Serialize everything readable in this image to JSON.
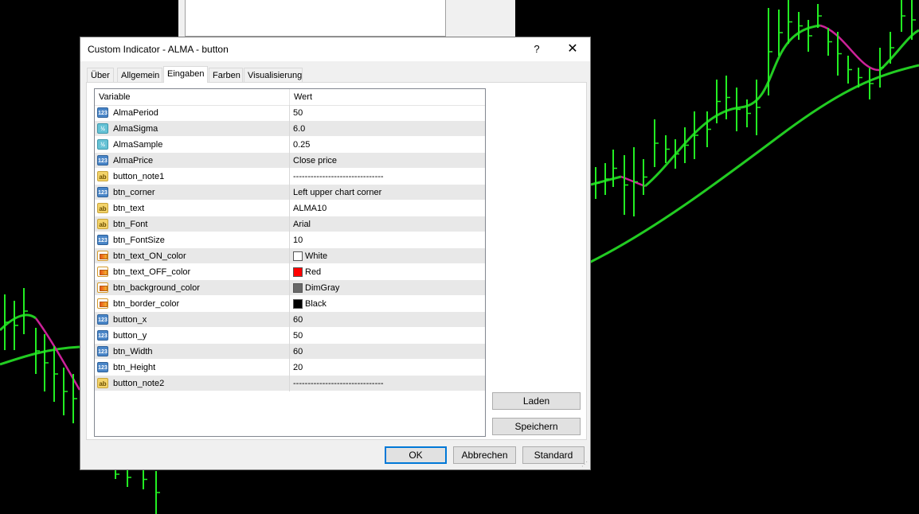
{
  "dialog": {
    "title": "Custom Indicator - ALMA  - button",
    "help_label": "?",
    "close_label": "✕"
  },
  "tabs": [
    {
      "label": "Über"
    },
    {
      "label": "Allgemein"
    },
    {
      "label": "Eingaben"
    },
    {
      "label": "Farben"
    },
    {
      "label": "Visualisierung"
    }
  ],
  "table": {
    "headers": {
      "variable": "Variable",
      "value": "Wert"
    },
    "rows": [
      {
        "type": "int",
        "icon": "123",
        "name": "AlmaPeriod",
        "value": "50"
      },
      {
        "type": "dbl",
        "icon": "½",
        "name": "AlmaSigma",
        "value": "6.0"
      },
      {
        "type": "dbl",
        "icon": "½",
        "name": "AlmaSample",
        "value": "0.25"
      },
      {
        "type": "int",
        "icon": "123",
        "name": "AlmaPrice",
        "value": "Close price"
      },
      {
        "type": "str",
        "icon": "ab",
        "name": "button_note1",
        "value": "-------------------------------"
      },
      {
        "type": "int",
        "icon": "123",
        "name": "btn_corner",
        "value": "Left upper chart corner"
      },
      {
        "type": "str",
        "icon": "ab",
        "name": "btn_text",
        "value": "ALMA10"
      },
      {
        "type": "str",
        "icon": "ab",
        "name": "btn_Font",
        "value": "Arial"
      },
      {
        "type": "int",
        "icon": "123",
        "name": "btn_FontSize",
        "value": "10"
      },
      {
        "type": "clr",
        "icon": "",
        "name": "btn_text_ON_color",
        "value": "White",
        "swatch": "#ffffff"
      },
      {
        "type": "clr",
        "icon": "",
        "name": "btn_text_OFF_color",
        "value": "Red",
        "swatch": "#ff0000"
      },
      {
        "type": "clr",
        "icon": "",
        "name": "btn_background_color",
        "value": "DimGray",
        "swatch": "#696969"
      },
      {
        "type": "clr",
        "icon": "",
        "name": "btn_border_color",
        "value": "Black",
        "swatch": "#000000"
      },
      {
        "type": "int",
        "icon": "123",
        "name": "button_x",
        "value": "60"
      },
      {
        "type": "int",
        "icon": "123",
        "name": "button_y",
        "value": "50"
      },
      {
        "type": "int",
        "icon": "123",
        "name": "btn_Width",
        "value": "60"
      },
      {
        "type": "int",
        "icon": "123",
        "name": "btn_Height",
        "value": "20"
      },
      {
        "type": "str",
        "icon": "ab",
        "name": "button_note2",
        "value": "-------------------------------"
      }
    ]
  },
  "buttons": {
    "load": "Laden",
    "save": "Speichern",
    "ok": "OK",
    "cancel": "Abbrechen",
    "reset": "Standard"
  },
  "colors": {
    "chart_background": "#000000",
    "candle": "#22ee22",
    "ma_up": "#22cc22",
    "ma_down": "#cc2299",
    "accent": "#0078d7"
  }
}
